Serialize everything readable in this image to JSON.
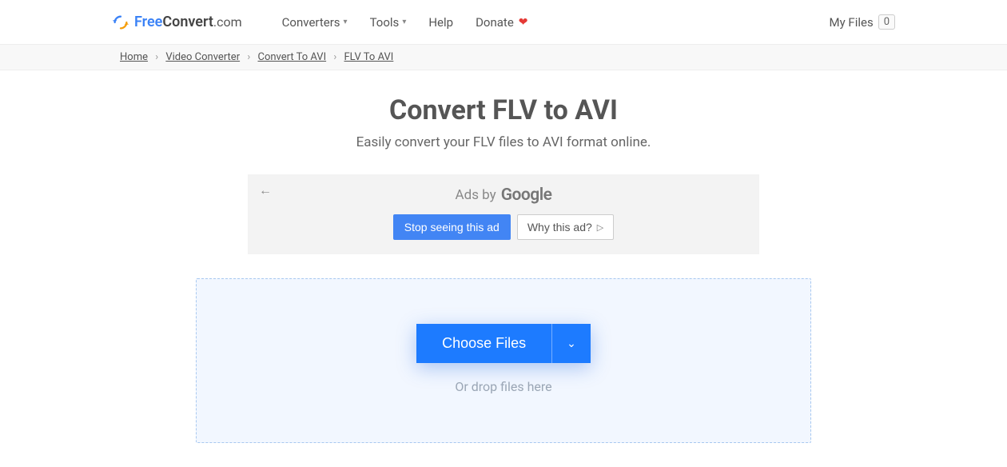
{
  "header": {
    "logo": {
      "free": "Free",
      "convert": "Convert",
      "dotcom": ".com"
    },
    "nav": {
      "converters": "Converters",
      "tools": "Tools",
      "help": "Help",
      "donate": "Donate"
    },
    "my_files_label": "My Files",
    "my_files_count": "0"
  },
  "breadcrumb": {
    "home": "Home",
    "video_converter": "Video Converter",
    "convert_to_avi": "Convert To AVI",
    "flv_to_avi": "FLV To AVI"
  },
  "main": {
    "title": "Convert FLV to AVI",
    "subtitle": "Easily convert your FLV files to AVI format online."
  },
  "ad": {
    "ads_by": "Ads by",
    "google": "Google",
    "stop_label": "Stop seeing this ad",
    "why_label": "Why this ad?"
  },
  "dropzone": {
    "choose_label": "Choose Files",
    "drop_text": "Or drop files here"
  }
}
